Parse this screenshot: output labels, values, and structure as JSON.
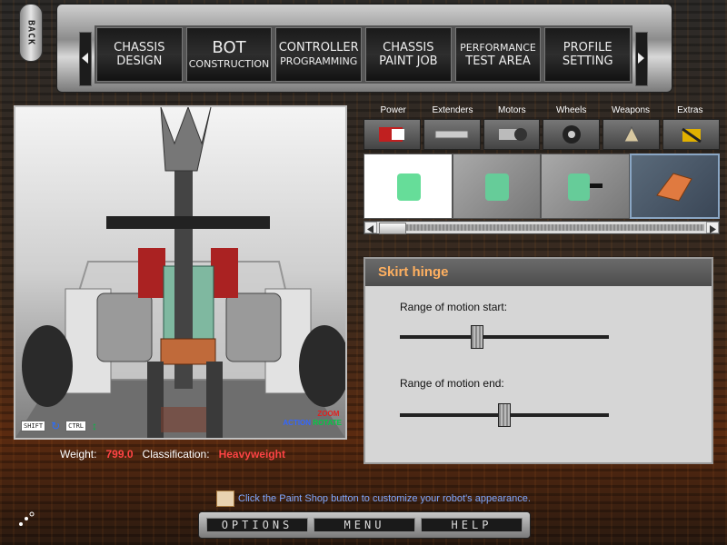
{
  "top_nav": {
    "back_label": "BACK",
    "buttons": [
      {
        "line1": "CHASSIS",
        "line2": "DESIGN"
      },
      {
        "line1": "BOT",
        "line2": "CONSTRUCTION"
      },
      {
        "line1": "CONTROLLER",
        "line2": "PROGRAMMING"
      },
      {
        "line1": "CHASSIS",
        "line2": "PAINT JOB"
      },
      {
        "line1": "PERFORMANCE",
        "line2": "TEST AREA"
      },
      {
        "line1": "PROFILE",
        "line2": "SETTING"
      }
    ]
  },
  "viewport": {
    "hint_shift": "SHIFT",
    "hint_ctrl": "CTRL",
    "action_label": "ACTION",
    "zoom_label": "ZOOM",
    "rotate_label": "ROTATE"
  },
  "stats": {
    "weight_label": "Weight:",
    "weight_value": "799.0",
    "class_label": "Classification:",
    "class_value": "Heavyweight"
  },
  "categories": [
    {
      "label": "Power",
      "icon": "battery-icon"
    },
    {
      "label": "Extenders",
      "icon": "extender-bar-icon"
    },
    {
      "label": "Motors",
      "icon": "motor-icon"
    },
    {
      "label": "Wheels",
      "icon": "wheel-icon"
    },
    {
      "label": "Weapons",
      "icon": "weapon-icon"
    },
    {
      "label": "Extras",
      "icon": "extras-icon"
    }
  ],
  "parts": [
    {
      "icon": "green-block-icon",
      "selected": true
    },
    {
      "icon": "green-block-icon",
      "selected": false
    },
    {
      "icon": "green-block-axle-icon",
      "selected": false
    },
    {
      "icon": "orange-plate-icon",
      "selected": false
    }
  ],
  "properties": {
    "title": "Skirt hinge",
    "slider_start_label": "Range of motion start:",
    "slider_start_value": 0.37,
    "slider_end_label": "Range of motion end:",
    "slider_end_value": 0.5
  },
  "bottom": {
    "tip": "Click the Paint Shop button to customize your robot's appearance.",
    "options": "OPTIONS",
    "menu": "MENU",
    "help": "HELP"
  },
  "colors": {
    "accent_orange": "#ffb060",
    "stat_red": "#ff4444",
    "tip_blue": "#7fa8ff"
  }
}
